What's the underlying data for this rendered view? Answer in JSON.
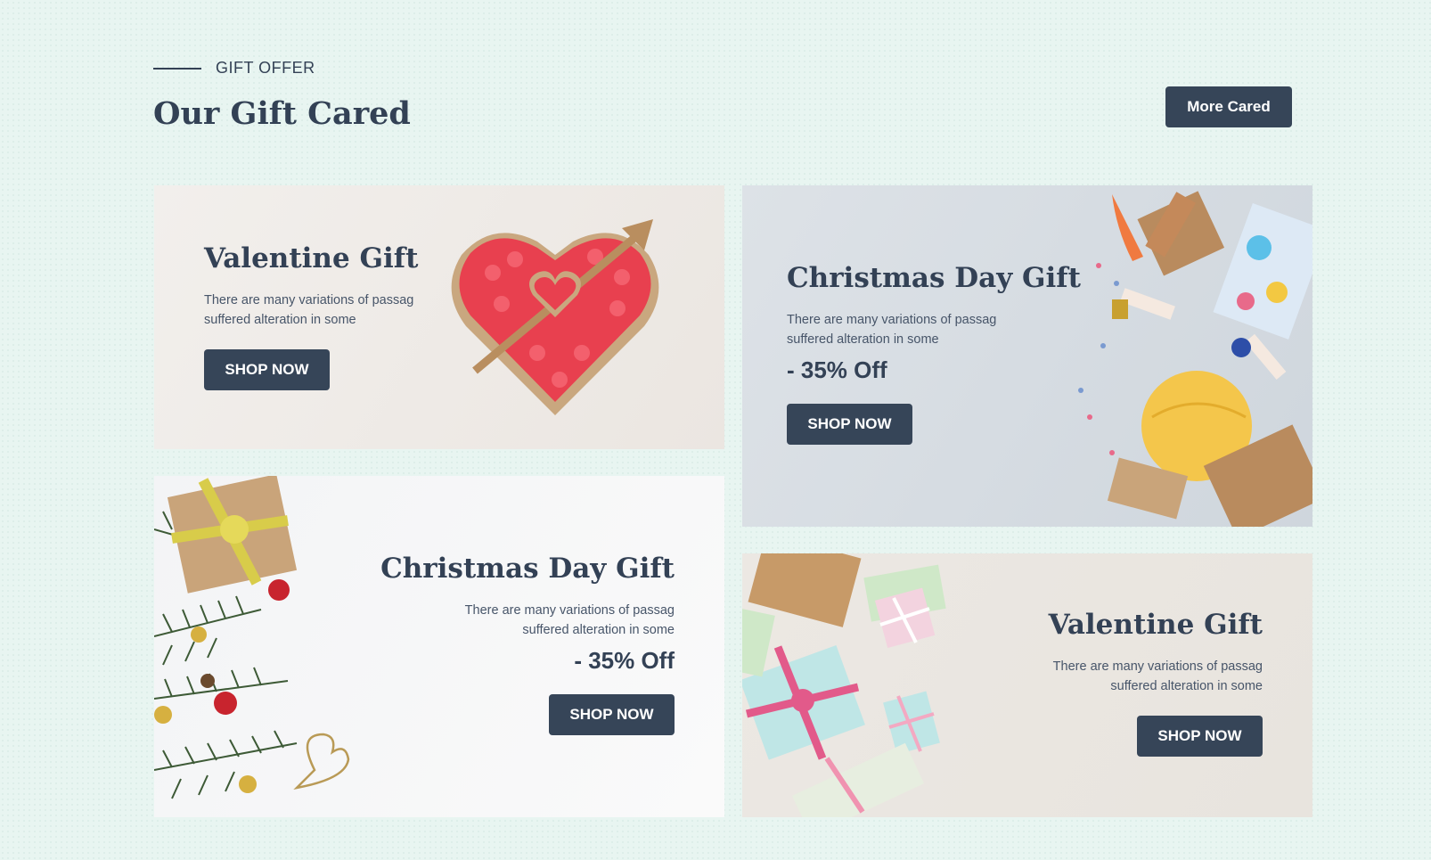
{
  "header": {
    "eyebrow": "GIFT OFFER",
    "title": "Our Gift Cared",
    "more_button": "More Cared"
  },
  "cards": [
    {
      "title": "Valentine Gift",
      "desc_line1": "There are many variations of passag",
      "desc_line2": "suffered alteration in some",
      "discount": "",
      "button": "SHOP NOW",
      "image": "heart-gift-box-image"
    },
    {
      "title": "Christmas Day Gift",
      "desc_line1": "There are many variations of passag",
      "desc_line2": "suffered alteration in some",
      "discount": "- 35% Off",
      "button": "SHOP NOW",
      "image": "party-gifts-image"
    },
    {
      "title": "Christmas Day Gift",
      "desc_line1": "There are many variations of passag",
      "desc_line2": "suffered alteration in some",
      "discount": "- 35% Off",
      "button": "SHOP NOW",
      "image": "christmas-branches-image"
    },
    {
      "title": "Valentine Gift",
      "desc_line1": "There are many variations of passag",
      "desc_line2": "suffered alteration in some",
      "discount": "",
      "button": "SHOP NOW",
      "image": "wrapped-gifts-image"
    }
  ],
  "colors": {
    "background": "#e8f5f1",
    "button": "#364558",
    "text": "#334155"
  }
}
